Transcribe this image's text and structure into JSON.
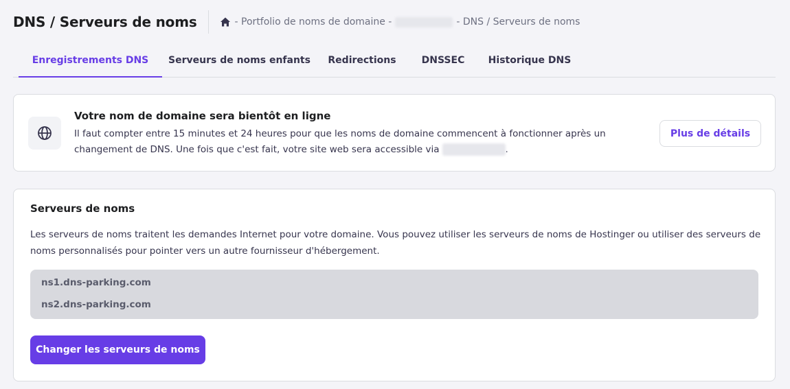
{
  "header": {
    "title": "DNS / Serveurs de noms",
    "breadcrumb": {
      "home_icon": "home-icon",
      "portfolio": "- Portfolio de noms de domaine -",
      "current": "- DNS / Serveurs de noms"
    }
  },
  "tabs": [
    {
      "label": "Enregistrements DNS",
      "active": true
    },
    {
      "label": "Serveurs de noms enfants",
      "active": false
    },
    {
      "label": "Redirections",
      "active": false
    },
    {
      "label": "DNSSEC",
      "active": false
    },
    {
      "label": "Historique DNS",
      "active": false
    }
  ],
  "notice": {
    "icon": "globe-icon",
    "title": "Votre nom de domaine sera bientôt en ligne",
    "text_before": "Il faut compter entre 15 minutes et 24 heures pour que les noms de domaine commencent à fonctionner après un changement de DNS. Une fois que c'est fait, votre site web sera accessible via",
    "text_after": ".",
    "details_button": "Plus de détails"
  },
  "nameservers": {
    "title": "Serveurs de noms",
    "description": "Les serveurs de noms traitent les demandes Internet pour votre domaine. Vous pouvez utiliser les serveurs de noms de Hostinger ou utiliser des serveurs de noms personnalisés pour pointer vers un autre fournisseur d'hébergement.",
    "items": [
      "ns1.dns-parking.com",
      "ns2.dns-parking.com"
    ],
    "change_button": "Changer les serveurs de noms"
  },
  "colors": {
    "accent": "#673de6",
    "background": "#f4f4f8",
    "nameserver_box": "#d8d9de"
  }
}
